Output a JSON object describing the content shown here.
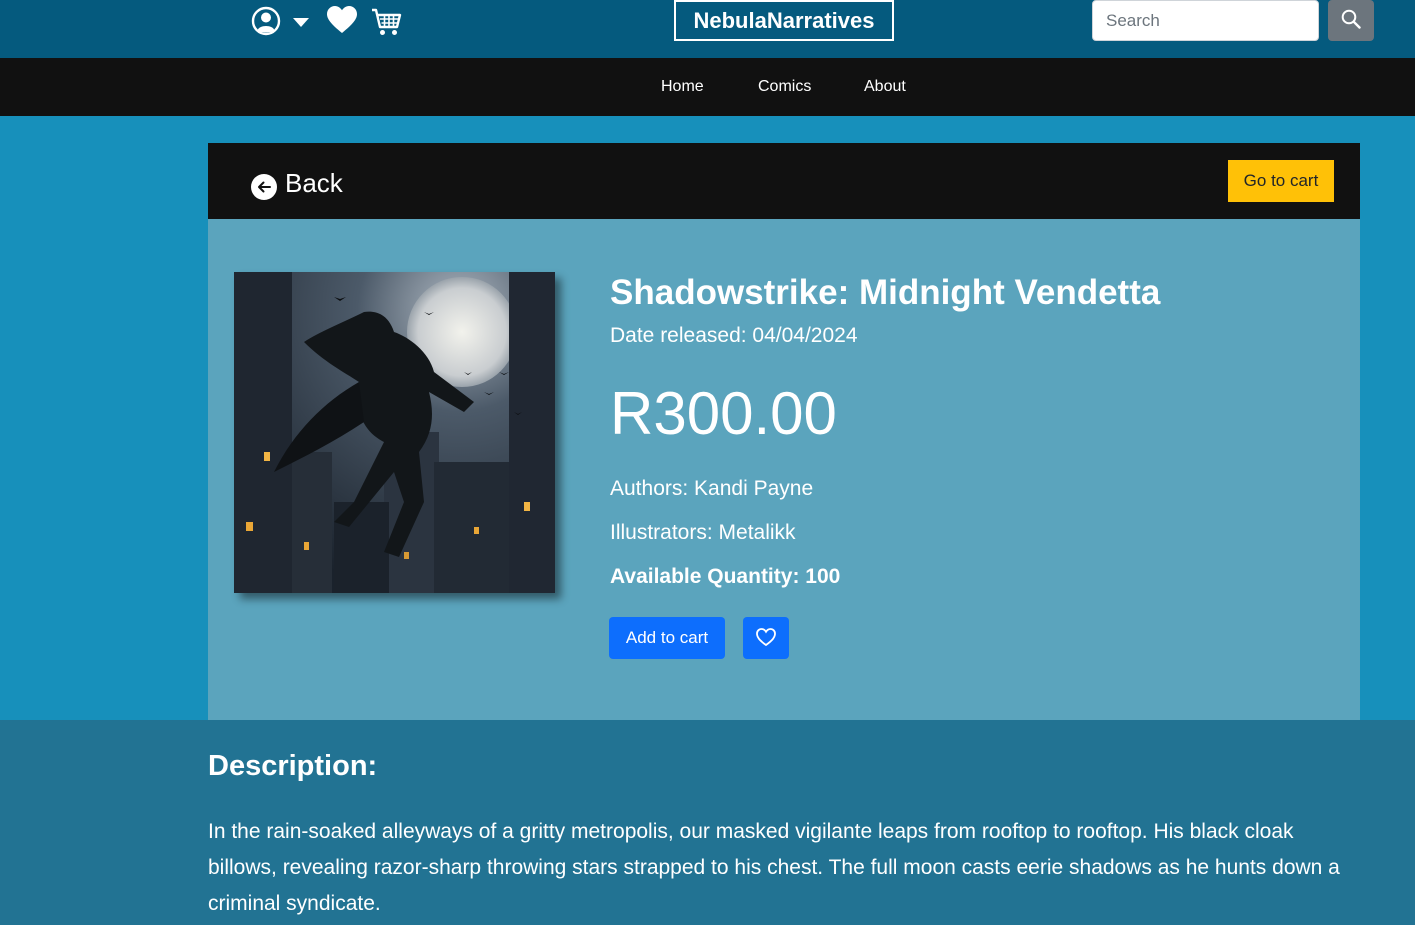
{
  "header": {
    "brand": "NebulaNarratives",
    "search_placeholder": "Search"
  },
  "nav": {
    "items": [
      "Home",
      "Comics",
      "About"
    ]
  },
  "card_header": {
    "back_label": "Back",
    "go_to_cart_label": "Go to cart"
  },
  "product": {
    "title": "Shadowstrike: Midnight Vendetta",
    "released": "Date released: 04/04/2024",
    "price": "R300.00",
    "authors": "Authors: Kandi Payne",
    "illustrators": "Illustrators: Metalikk",
    "quantity": "Available Quantity: 100",
    "add_to_cart_label": "Add to cart"
  },
  "description": {
    "heading": "Description:",
    "text": "In the rain-soaked alleyways of a gritty metropolis, our masked vigilante leaps from rooftop to rooftop. His black cloak billows, revealing razor-sharp throwing stars strapped to his chest. The full moon casts eerie shadows as he hunts down a criminal syndicate."
  },
  "icons": {
    "user": "user-circle-icon",
    "caret": "caret-down-icon",
    "wishlist": "heart-icon",
    "cart": "cart-icon",
    "search": "search-icon",
    "back": "arrow-left-circle-icon",
    "favorite": "heart-outline-icon"
  },
  "colors": {
    "topbar": "#055a7e",
    "navbar": "#111111",
    "page_bg": "#1790bb",
    "card_body": "#5ba4bd",
    "description_bg": "#227393",
    "primary": "#0d6efd",
    "warning": "#ffc107"
  }
}
